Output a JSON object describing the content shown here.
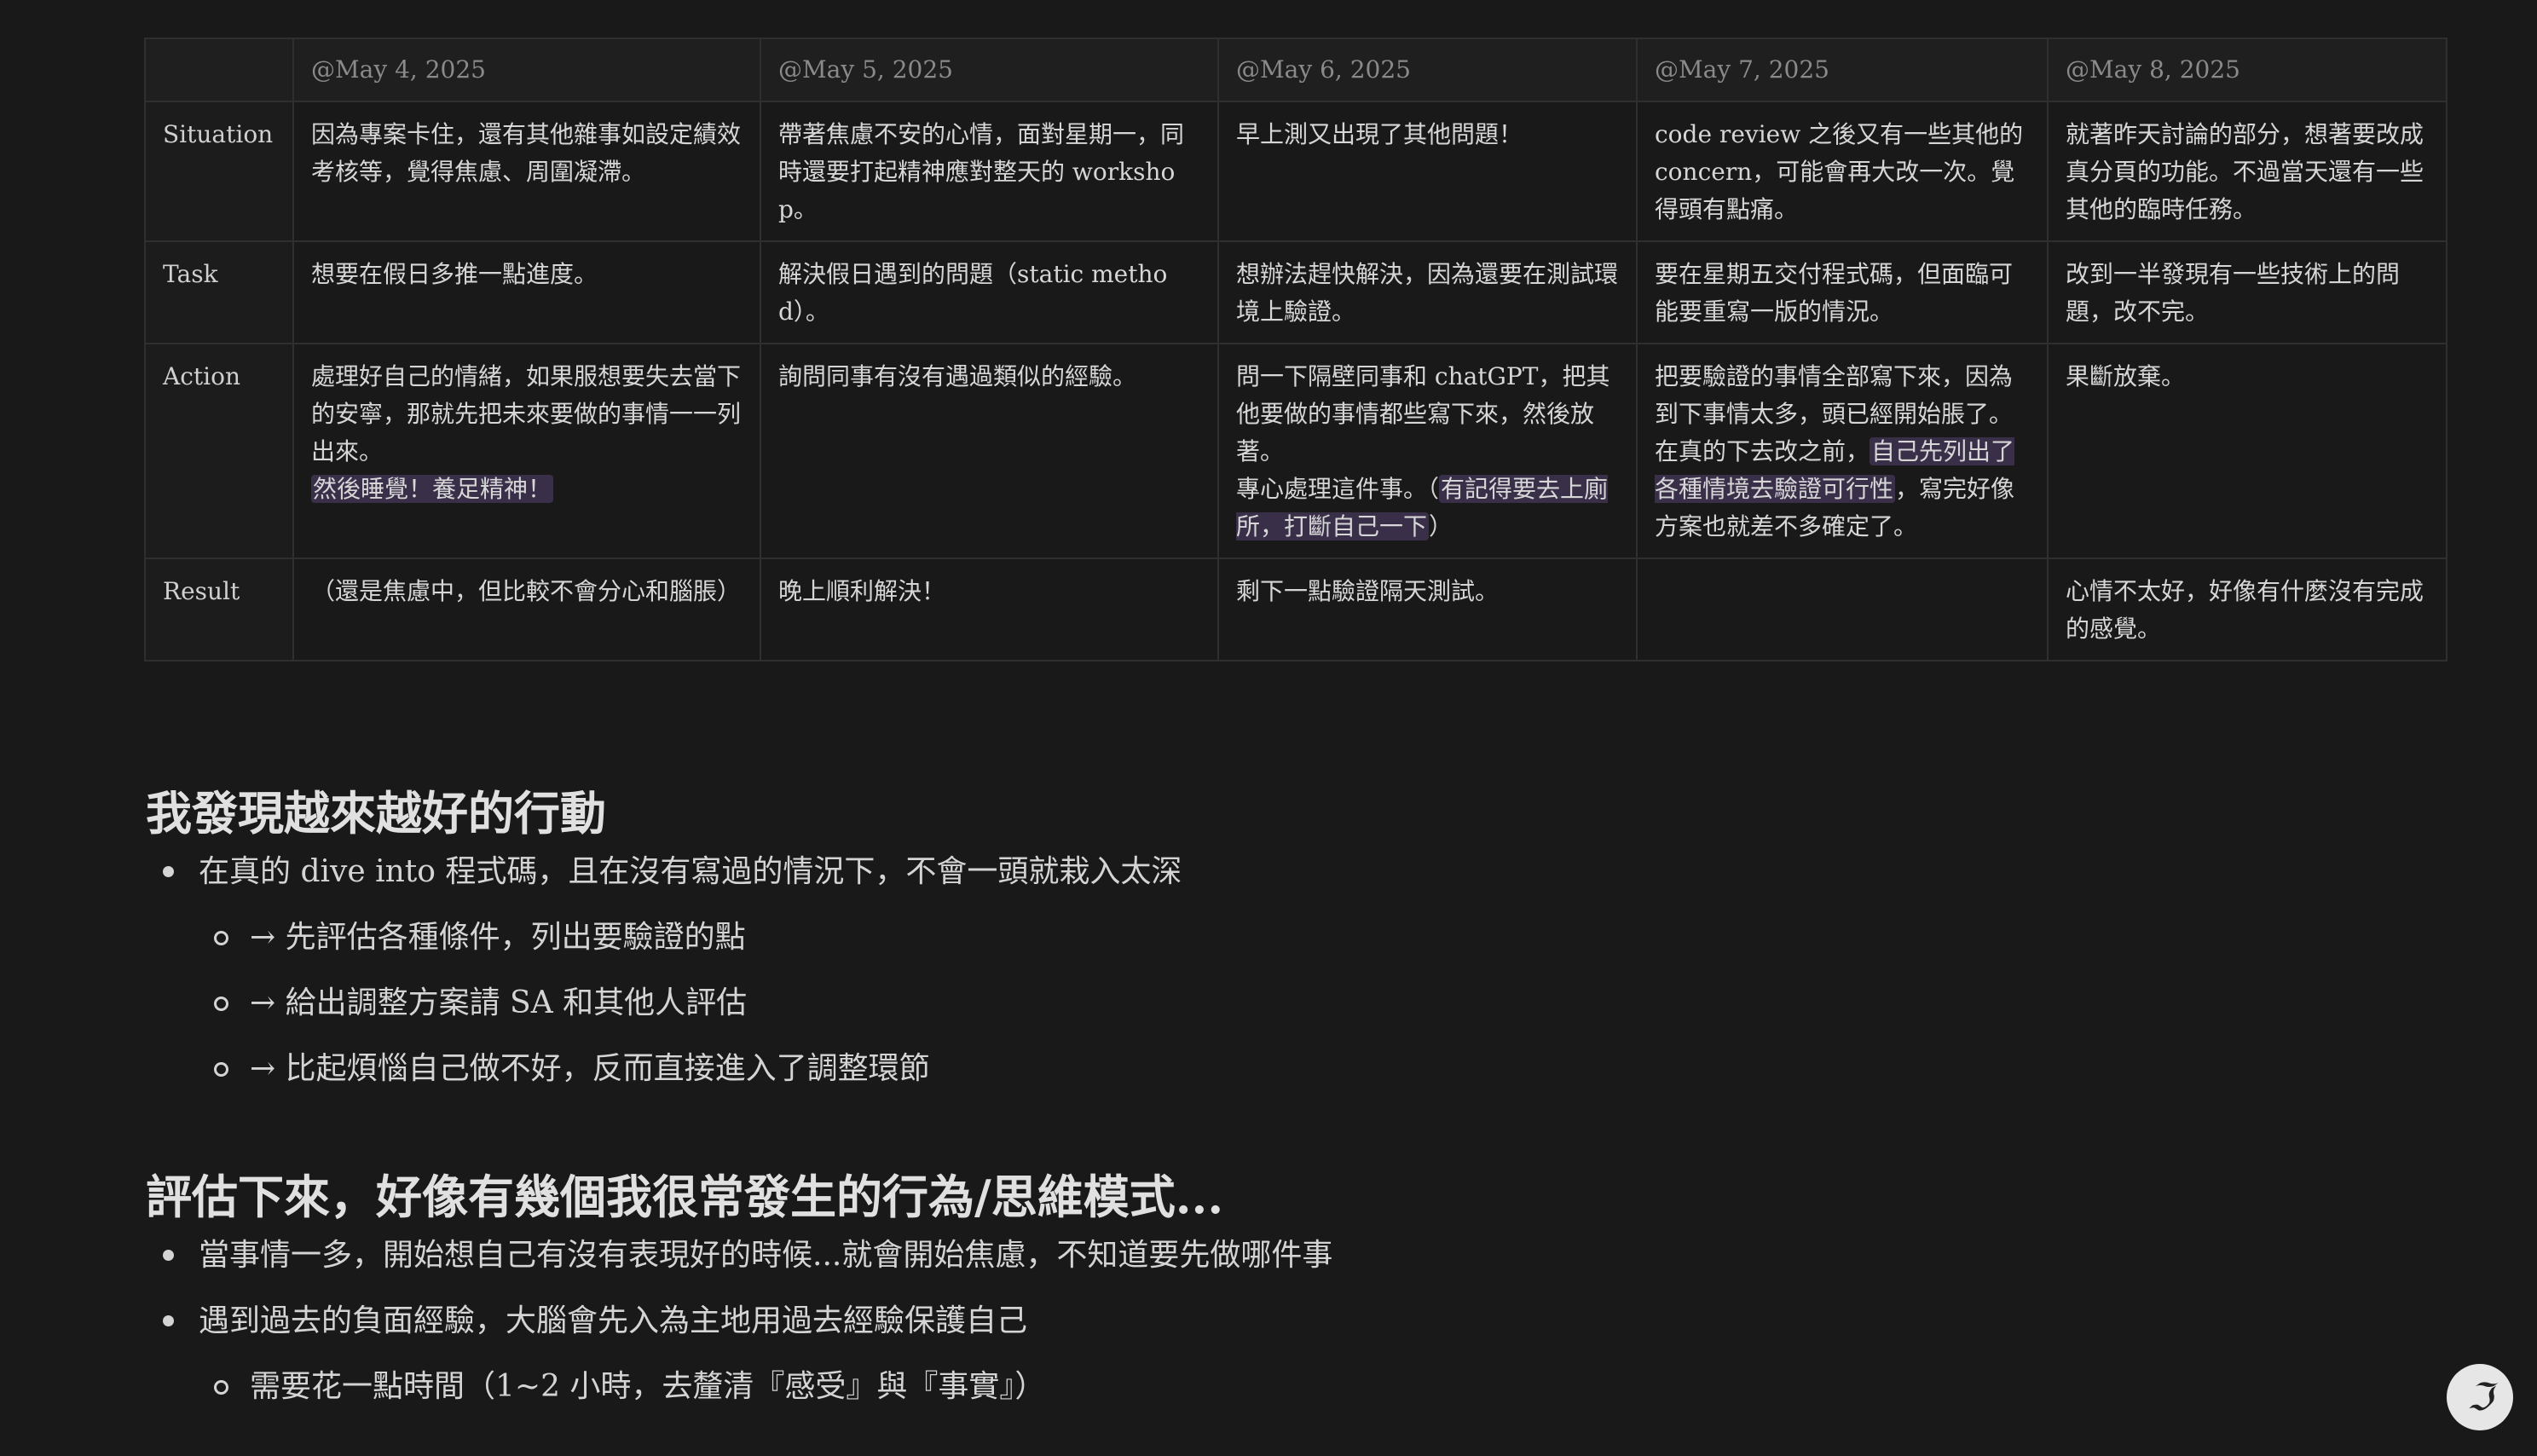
{
  "table": {
    "columns": [
      "",
      "@May 4, 2025",
      "@May 5, 2025",
      "@May 6, 2025",
      "@May 7, 2025",
      "@May 8, 2025"
    ],
    "rows": [
      {
        "label": "Situation",
        "cells": [
          [
            {
              "t": "因為專案卡住，還有其他雜事如設定績效考核等，覺得焦慮、周圍凝滯。"
            }
          ],
          [
            {
              "t": "帶著焦慮不安的心情，面對星期一，同時還要打起精神應對整天的 workshop。"
            }
          ],
          [
            {
              "t": "早上測又出現了其他問題！"
            }
          ],
          [
            {
              "t": "code review 之後又有一些其他的 concern，可能會再大改一次。覺得頭有點痛。"
            }
          ],
          [
            {
              "t": "就著昨天討論的部分，想著要改成真分頁的功能。不過當天還有一些其他的臨時任務。"
            }
          ]
        ]
      },
      {
        "label": "Task",
        "cells": [
          [
            {
              "t": "想要在假日多推一點進度。"
            }
          ],
          [
            {
              "t": "解決假日遇到的問題（static method）。"
            }
          ],
          [
            {
              "t": "想辦法趕快解決，因為還要在測試環境上驗證。"
            }
          ],
          [
            {
              "t": "要在星期五交付程式碼，但面臨可能要重寫一版的情況。"
            }
          ],
          [
            {
              "t": "改到一半發現有一些技術上的問題，改不完。"
            }
          ]
        ]
      },
      {
        "label": "Action",
        "cells": [
          [
            {
              "t": "處理好自己的情緒，如果服想要失去當下的安寧，那就先把未來要做的事情一一列出來。"
            },
            {
              "br": true
            },
            {
              "t": "然後睡覺！養足精神！",
              "hl": true
            }
          ],
          [
            {
              "t": "詢問同事有沒有遇過類似的經驗。"
            }
          ],
          [
            {
              "t": "問一下隔壁同事和 chatGPT，把其他要做的事情都些寫下來，然後放著。"
            },
            {
              "br": true
            },
            {
              "t": "專心處理這件事。（"
            },
            {
              "t": "有記得要去上廁所，打斷自己一下",
              "hl": true
            },
            {
              "t": "）"
            }
          ],
          [
            {
              "t": "把要驗證的事情全部寫下來，因為到下事情太多，頭已經開始脹了。"
            },
            {
              "br": true
            },
            {
              "t": "在真的下去改之前，"
            },
            {
              "t": "自己先列出了各種情境去驗證可行性",
              "hl": true
            },
            {
              "t": "，寫完好像方案也就差不多確定了。"
            }
          ],
          [
            {
              "t": "果斷放棄。"
            }
          ]
        ]
      },
      {
        "label": "Result",
        "cells": [
          [
            {
              "t": "（還是焦慮中，但比較不會分心和腦脹）"
            }
          ],
          [
            {
              "t": "晚上順利解決！"
            }
          ],
          [
            {
              "t": "剩下一點驗證隔天測試。"
            }
          ],
          [
            {
              "t": ""
            }
          ],
          [
            {
              "t": "心情不太好，好像有什麼沒有完成的感覺。"
            }
          ]
        ]
      }
    ]
  },
  "section1": {
    "heading": "我發現越來越好的行動",
    "items": [
      {
        "level": 1,
        "text": "在真的 dive into 程式碼，且在沒有寫過的情況下，不會一頭就栽入太深"
      },
      {
        "level": 2,
        "text": "→ 先評估各種條件，列出要驗證的點"
      },
      {
        "level": 2,
        "text": "→ 給出調整方案請 SA 和其他人評估"
      },
      {
        "level": 2,
        "text": "→ 比起煩惱自己做不好，反而直接進入了調整環節"
      }
    ]
  },
  "section2": {
    "heading": "評估下來，好像有幾個我很常發生的行為/思維模式...",
    "items": [
      {
        "level": 1,
        "text": "當事情一多，開始想自己有沒有表現好的時候...就會開始焦慮，不知道要先做哪件事"
      },
      {
        "level": 1,
        "text": "遇到過去的負面經驗，大腦會先入為主地用過去經驗保護自己"
      },
      {
        "level": 2,
        "text": "需要花一點時間（1~2 小時，去釐清『感受』與『事實』）"
      }
    ]
  },
  "help_button": {
    "icon": "help-icon"
  },
  "colors": {
    "background": "#191919",
    "highlight": "#3a2f49",
    "border": "#2f2f2f"
  }
}
